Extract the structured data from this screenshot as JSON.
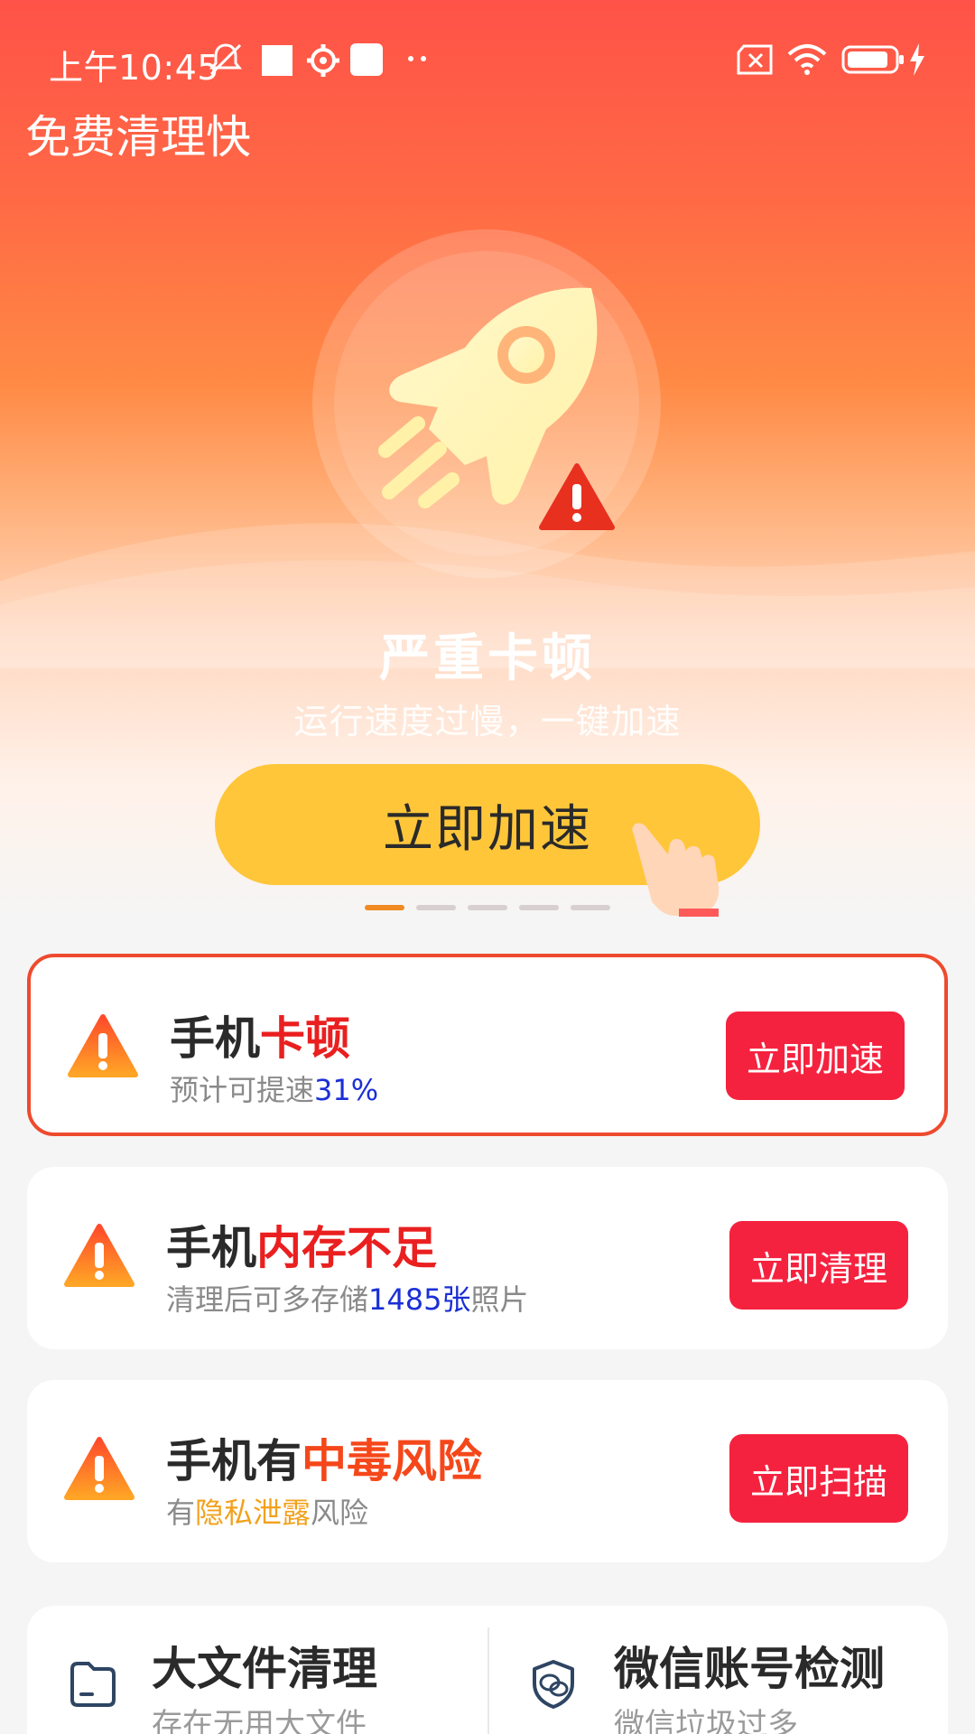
{
  "status_bar": {
    "time": "上午10:45"
  },
  "app": {
    "title": "免费清理快"
  },
  "hero": {
    "title": "严重卡顿",
    "subtitle": "运行速度过慢，一键加速",
    "button_label": "立即加速",
    "page_indicator": {
      "count": 5,
      "active_index": 0
    }
  },
  "cards": [
    {
      "title_prefix": "手机",
      "title_highlight": "卡顿",
      "desc_prefix": "预计可提速",
      "desc_highlight": "31%",
      "desc_suffix": "",
      "action_label": "立即加速"
    },
    {
      "title_prefix": "手机",
      "title_highlight": "内存不足",
      "desc_prefix": "清理后可多存储",
      "desc_highlight": "1485张",
      "desc_suffix": "照片",
      "action_label": "立即清理"
    },
    {
      "title_prefix": "手机有",
      "title_highlight": "中毒风险",
      "desc_prefix": "有",
      "desc_highlight": "隐私泄露",
      "desc_suffix": "风险",
      "action_label": "立即扫描"
    }
  ],
  "tools": [
    {
      "name": "大文件清理",
      "desc": "存在无用大文件",
      "icon": "folder-icon"
    },
    {
      "name": "微信账号检测",
      "desc": "微信垃圾过多",
      "icon": "wechat-shield-icon"
    }
  ],
  "colors": {
    "hero_top": "#ff5248",
    "button_yellow": "#ffc63a",
    "action_red": "#f5223f",
    "highlight_red": "#ea1f1f",
    "highlight_blue": "#1b2fd6",
    "highlight_gold": "#f2a11d"
  }
}
